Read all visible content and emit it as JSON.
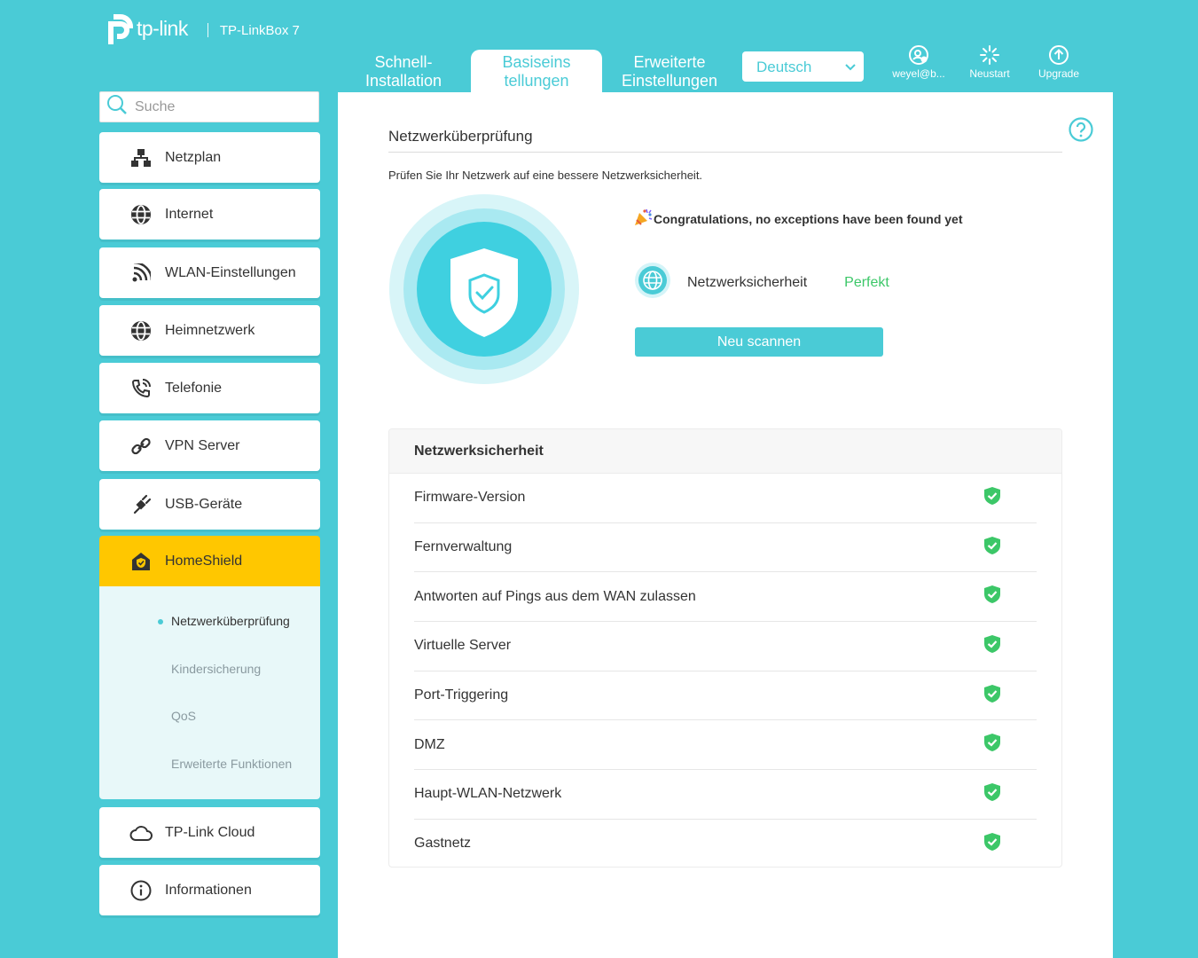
{
  "header": {
    "brand": "tp-link",
    "model": "TP-LinkBox 7",
    "tabs": [
      {
        "line1": "Schnell-",
        "line2": "Installation"
      },
      {
        "line1": "Basiseins",
        "line2": "tellungen"
      },
      {
        "line1": "Erweiterte",
        "line2": "Einstellungen"
      }
    ],
    "language": "Deutsch",
    "account_label": "weyel@b...",
    "restart_label": "Neustart",
    "upgrade_label": "Upgrade"
  },
  "sidebar": {
    "search_placeholder": "Suche",
    "items": [
      {
        "label": "Netzplan",
        "icon": "network-map-icon"
      },
      {
        "label": "Internet",
        "icon": "globe-icon"
      },
      {
        "label": "WLAN-Einstellungen",
        "icon": "wifi-icon"
      },
      {
        "label": "Heimnetzwerk",
        "icon": "globe-icon"
      },
      {
        "label": "Telefonie",
        "icon": "phone-icon"
      },
      {
        "label": "VPN Server",
        "icon": "link-icon"
      },
      {
        "label": "USB-Geräte",
        "icon": "usb-icon"
      },
      {
        "label": "HomeShield",
        "icon": "homeshield-icon"
      },
      {
        "label": "TP-Link Cloud",
        "icon": "cloud-icon"
      },
      {
        "label": "Informationen",
        "icon": "info-icon"
      }
    ],
    "subitems": [
      "Netzwerküberprüfung",
      "Kindersicherung",
      "QoS",
      "Erweiterte Funktionen"
    ]
  },
  "main": {
    "title": "Netzwerküberprüfung",
    "description": "Prüfen Sie Ihr Netzwerk auf eine bessere Netzwerksicherheit.",
    "congrats": "Congratulations, no exceptions have been found yet",
    "security_label": "Netzwerksicherheit",
    "security_status": "Perfekt",
    "scan_button": "Neu scannen",
    "table_title": "Netzwerksicherheit",
    "rows": [
      "Firmware-Version",
      "Fernverwaltung",
      "Antworten auf Pings aus dem WAN zulassen",
      "Virtuelle Server",
      "Port-Triggering",
      "DMZ",
      "Haupt-WLAN-Netzwerk",
      "Gastnetz"
    ]
  },
  "colors": {
    "accent": "#4acbd6",
    "active_nav": "#ffc700",
    "ok_green": "#3cc768"
  }
}
